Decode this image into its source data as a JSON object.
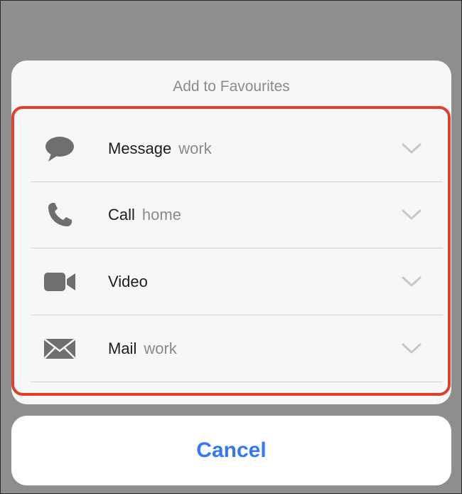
{
  "sheet": {
    "title": "Add to Favourites"
  },
  "options": [
    {
      "icon": "message-bubble-icon",
      "label": "Message",
      "detail": "work"
    },
    {
      "icon": "phone-icon",
      "label": "Call",
      "detail": "home"
    },
    {
      "icon": "video-camera-icon",
      "label": "Video",
      "detail": ""
    },
    {
      "icon": "mail-envelope-icon",
      "label": "Mail",
      "detail": "work"
    }
  ],
  "cancel_label": "Cancel",
  "colors": {
    "highlight_border": "#e0402a",
    "cancel_text": "#3478f6",
    "icon_gray": "#6e6e6e",
    "chevron_gray": "#c7c7cc",
    "overlay": "#8e8e8e"
  }
}
